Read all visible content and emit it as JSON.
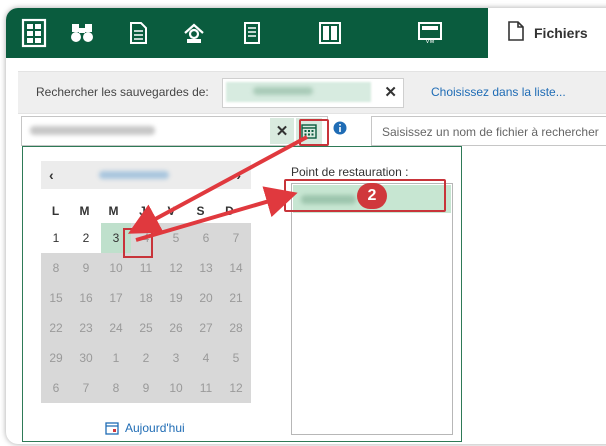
{
  "toolbar": {
    "icons": [
      "database-icon",
      "binoculars-icon",
      "document-icon",
      "gear-house-icon",
      "scroll-icon",
      "window-icon",
      "vm-icon"
    ],
    "active_tab_label": "Fichiers",
    "vm_badge": "VM"
  },
  "search": {
    "label": "Rechercher les sauvegardes de:",
    "clear": "✕",
    "choose_link": "Choisissez dans la liste..."
  },
  "date_field": {
    "clear": "✕"
  },
  "filename_field": {
    "placeholder": "Saisissez un nom de fichier à rechercher"
  },
  "calendar": {
    "prev": "‹",
    "next": "›",
    "weekdays": [
      "L",
      "M",
      "M",
      "J",
      "V",
      "S",
      "D"
    ],
    "weeks": [
      [
        "1",
        "2",
        "3",
        "4",
        "5",
        "6",
        "7"
      ],
      [
        "8",
        "9",
        "10",
        "11",
        "12",
        "13",
        "14"
      ],
      [
        "15",
        "16",
        "17",
        "18",
        "19",
        "20",
        "21"
      ],
      [
        "22",
        "23",
        "24",
        "25",
        "26",
        "27",
        "28"
      ],
      [
        "29",
        "30",
        "1",
        "2",
        "3",
        "4",
        "5"
      ],
      [
        "6",
        "7",
        "8",
        "9",
        "10",
        "11",
        "12"
      ]
    ],
    "enabled_days": [
      "1",
      "2",
      "3"
    ],
    "selected_day": "3",
    "today_label": "Aujourd'hui"
  },
  "restore_points": {
    "label": "Point de restauration :"
  },
  "annotation": {
    "step_number": "2",
    "color": "#d0383c"
  },
  "colors": {
    "brand_green": "#0a5c3e",
    "selection_green": "#bfe0cc",
    "link_blue": "#1f6cb5"
  }
}
